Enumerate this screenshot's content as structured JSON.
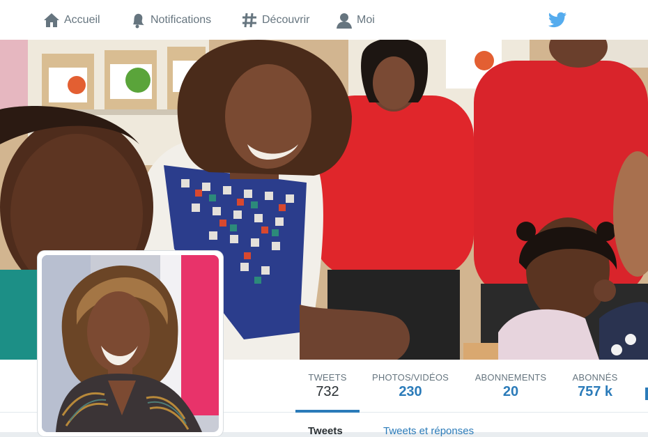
{
  "nav": {
    "home": {
      "label": "Accueil",
      "icon": "home-icon"
    },
    "notifications": {
      "label": "Notifications",
      "icon": "bell-icon"
    },
    "discover": {
      "label": "Découvrir",
      "icon": "hashtag-icon"
    },
    "me": {
      "label": "Moi",
      "icon": "user-icon"
    },
    "logo_icon": "twitter-bird-icon"
  },
  "stats": [
    {
      "label": "TWEETS",
      "value": "732"
    },
    {
      "label": "PHOTOS/VIDÉOS",
      "value": "230"
    },
    {
      "label": "ABONNEMENTS",
      "value": "20"
    },
    {
      "label": "ABONNÉS",
      "value": "757 k"
    }
  ],
  "tabs": {
    "tweets": "Tweets",
    "replies": "Tweets et réponses"
  },
  "colors": {
    "accent": "#2b7bb9",
    "nav_text": "#66757f",
    "twitter_blue": "#55acee"
  }
}
